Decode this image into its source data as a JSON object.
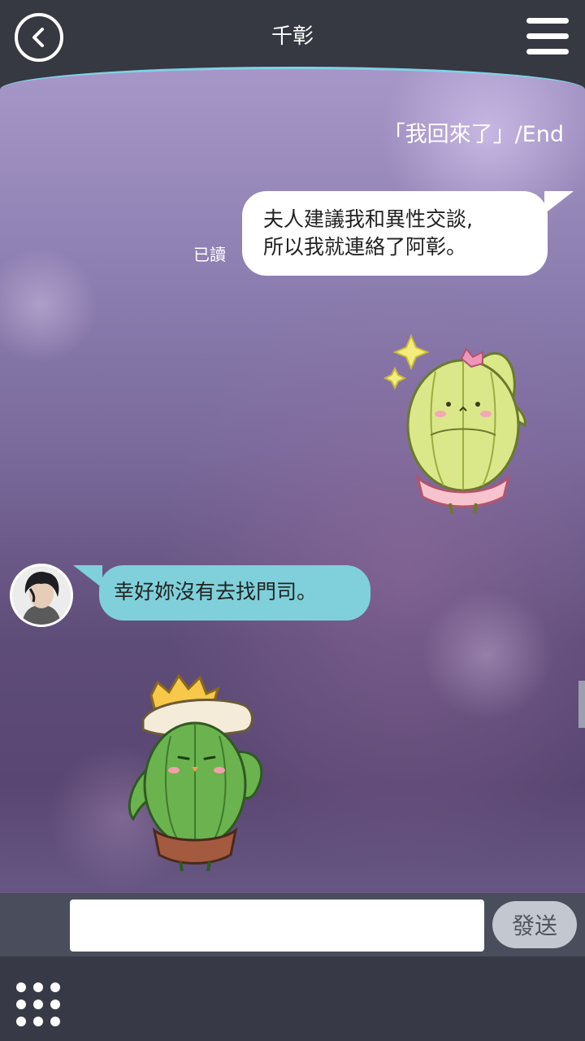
{
  "header": {
    "title": "千彰"
  },
  "chat": {
    "status_line": "「我回來了」/End",
    "messages": [
      {
        "side": "right",
        "lines": [
          "夫人建議我和異性交談,",
          "所以我就連絡了阿彰。"
        ],
        "read_label": "已讀"
      },
      {
        "side": "left",
        "text": "幸好妳沒有去找門司。"
      }
    ],
    "stickers": [
      "cactus-girl-sticker",
      "cactus-boy-sticker"
    ]
  },
  "input": {
    "value": "",
    "send_label": "發送"
  },
  "colors": {
    "header_bg": "#363842",
    "right_bubble": "#ffffff",
    "left_bubble": "#7fd0da",
    "send_button": "#c3c7cf"
  }
}
